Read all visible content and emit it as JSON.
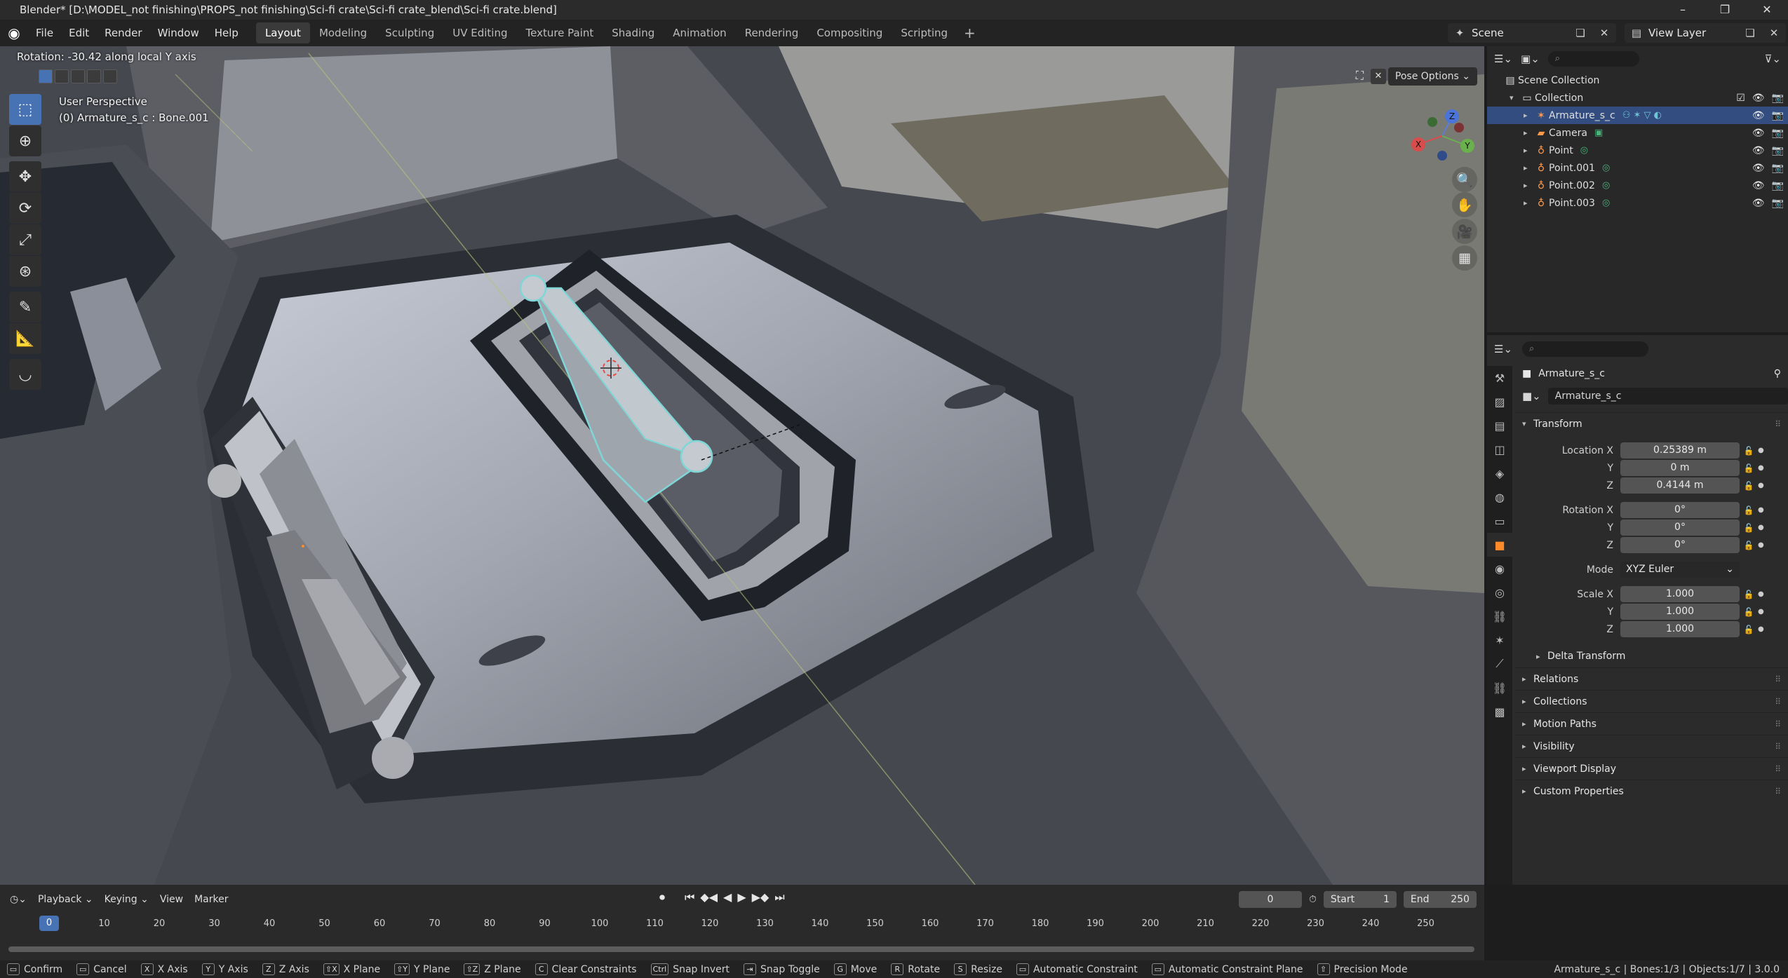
{
  "window": {
    "title": "Blender* [D:\\MODEL_not finishing\\PROPS_not finishing\\Sci-fi crate\\Sci-fi crate_blend\\Sci-fi crate.blend]",
    "controls": [
      "–",
      "❐",
      "✕"
    ]
  },
  "menubar": {
    "menus": [
      "File",
      "Edit",
      "Render",
      "Window",
      "Help"
    ],
    "workspaces": [
      "Layout",
      "Modeling",
      "Sculpting",
      "UV Editing",
      "Texture Paint",
      "Shading",
      "Animation",
      "Rendering",
      "Compositing",
      "Scripting"
    ],
    "active_workspace": "Layout",
    "scene": "Scene",
    "view_layer": "View Layer"
  },
  "viewport": {
    "operator_status": "Rotation: -30.42 along local Y axis",
    "perspective": "User Perspective",
    "active_info": "(0) Armature_s_c : Bone.001",
    "pose_options": "Pose Options",
    "gizmo_axes": {
      "x": "X",
      "y": "Y",
      "z": "Z"
    }
  },
  "outliner": {
    "root": "Scene Collection",
    "collection": "Collection",
    "items": [
      {
        "name": "Armature_s_c",
        "selected": true
      },
      {
        "name": "Camera",
        "selected": false
      },
      {
        "name": "Point",
        "selected": false
      },
      {
        "name": "Point.001",
        "selected": false
      },
      {
        "name": "Point.002",
        "selected": false
      },
      {
        "name": "Point.003",
        "selected": false
      }
    ]
  },
  "properties": {
    "object_name": "Armature_s_c",
    "data_name": "Armature_s_c",
    "transform_title": "Transform",
    "location": {
      "label_x": "Location X",
      "x": "0.25389 m",
      "label_y": "Y",
      "y": "0 m",
      "label_z": "Z",
      "z": "0.4144 m"
    },
    "rotation": {
      "label_x": "Rotation X",
      "x": "0°",
      "label_y": "Y",
      "y": "0°",
      "label_z": "Z",
      "z": "0°"
    },
    "mode": {
      "label": "Mode",
      "value": "XYZ Euler"
    },
    "scale": {
      "label_x": "Scale X",
      "x": "1.000",
      "label_y": "Y",
      "y": "1.000",
      "label_z": "Z",
      "z": "1.000"
    },
    "panels": [
      "Delta Transform",
      "Relations",
      "Collections",
      "Motion Paths",
      "Visibility",
      "Viewport Display",
      "Custom Properties"
    ]
  },
  "timeline": {
    "menus": [
      "Playback",
      "Keying",
      "View",
      "Marker"
    ],
    "current_frame": "0",
    "start_label": "Start",
    "start": "1",
    "end_label": "End",
    "end": "250",
    "ticks": [
      "0",
      "10",
      "20",
      "30",
      "40",
      "50",
      "60",
      "70",
      "80",
      "90",
      "100",
      "110",
      "120",
      "130",
      "140",
      "150",
      "160",
      "170",
      "180",
      "190",
      "200",
      "210",
      "220",
      "230",
      "240",
      "250"
    ]
  },
  "statusbar": {
    "items": [
      {
        "key": "",
        "label": "Confirm"
      },
      {
        "key": "",
        "label": "Cancel"
      },
      {
        "key": "X",
        "label": "X Axis"
      },
      {
        "key": "Y",
        "label": "Y Axis"
      },
      {
        "key": "Z",
        "label": "Z Axis"
      },
      {
        "key": "⇧X",
        "label": "X Plane"
      },
      {
        "key": "⇧Y",
        "label": "Y Plane"
      },
      {
        "key": "⇧Z",
        "label": "Z Plane"
      },
      {
        "key": "C",
        "label": "Clear Constraints"
      },
      {
        "key": "Ctrl",
        "label": "Snap Invert"
      },
      {
        "key": "⇥",
        "label": "Snap Toggle"
      },
      {
        "key": "G",
        "label": "Move"
      },
      {
        "key": "R",
        "label": "Rotate"
      },
      {
        "key": "S",
        "label": "Resize"
      },
      {
        "key": "",
        "label": "Automatic Constraint"
      },
      {
        "key": "",
        "label": "Automatic Constraint Plane"
      },
      {
        "key": "⇧",
        "label": "Precision Mode"
      }
    ],
    "stats": "Armature_s_c | Bones:1/3 | Objects:1/7 | 3.0.0"
  },
  "colors": {
    "accent": "#4772b3",
    "selection": "#334d80",
    "active_tab": "#ff8a2a",
    "bone_outline": "#7fd6d6"
  }
}
